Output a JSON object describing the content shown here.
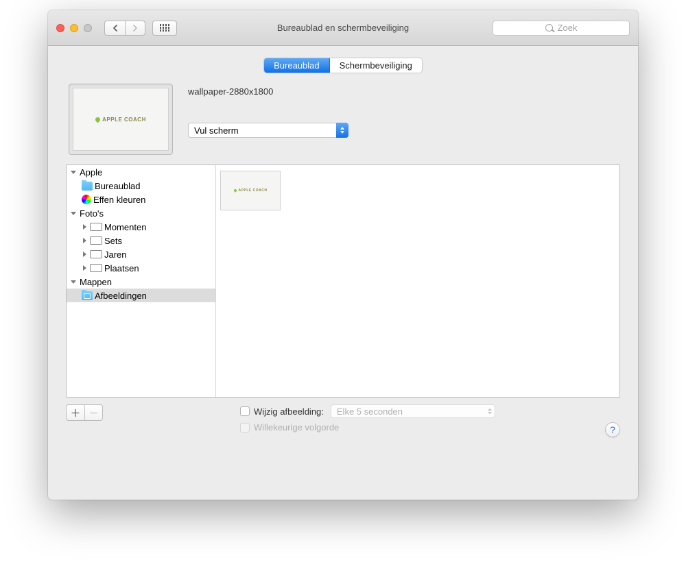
{
  "window": {
    "title": "Bureaublad en schermbeveiliging",
    "search_placeholder": "Zoek"
  },
  "tabs": {
    "desktop": "Bureaublad",
    "screensaver": "Schermbeveiliging"
  },
  "current": {
    "wallpaper_name": "wallpaper-2880x1800",
    "preview_text": "APPLE COACH",
    "fill_mode": "Vul scherm"
  },
  "sidebar": {
    "apple": {
      "label": "Apple",
      "desktop": "Bureaublad",
      "solid": "Effen kleuren"
    },
    "photos": {
      "label": "Foto's",
      "moments": "Momenten",
      "sets": "Sets",
      "years": "Jaren",
      "places": "Plaatsen"
    },
    "folders": {
      "label": "Mappen",
      "pictures": "Afbeeldingen"
    }
  },
  "options": {
    "change_label": "Wijzig afbeelding:",
    "interval": "Elke 5 seconden",
    "random_label": "Willekeurige volgorde"
  },
  "buttons": {
    "add": "＋",
    "remove": "－",
    "help": "?"
  }
}
